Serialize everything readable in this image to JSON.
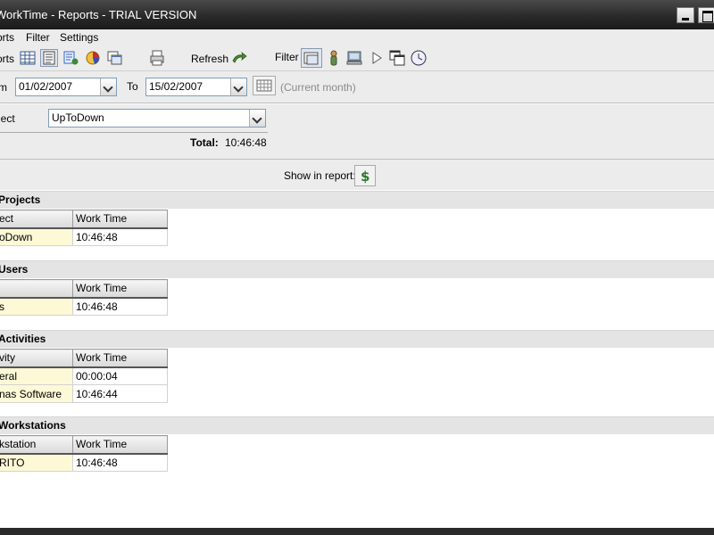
{
  "window": {
    "title": "WorkTime - Reports - TRIAL VERSION"
  },
  "menu": {
    "items": [
      "orts",
      "Filter",
      "Settings"
    ]
  },
  "toolbar": {
    "reports_label": "orts",
    "refresh_label": "Refresh",
    "filter_label": "Filter"
  },
  "dates": {
    "from_label": "m",
    "from_value": "01/02/2007",
    "to_label": "To",
    "to_value": "15/02/2007",
    "hint": "(Current month)"
  },
  "project": {
    "label": "ject",
    "value": "UpToDown",
    "total_label": "Total:",
    "total_value": "10:46:48"
  },
  "show": {
    "label": "Show in report:"
  },
  "sections": {
    "projects": {
      "title": "Projects",
      "headers": [
        "ect",
        "Work Time"
      ],
      "rows": [
        [
          "oDown",
          "10:46:48"
        ]
      ]
    },
    "users": {
      "title": "Users",
      "headers": [
        "",
        "Work Time"
      ],
      "rows": [
        [
          "s",
          "10:46:48"
        ]
      ]
    },
    "activities": {
      "title": "Activities",
      "headers": [
        "vity",
        "Work Time"
      ],
      "rows": [
        [
          "eral",
          "00:00:04"
        ],
        [
          "nas Software",
          "10:46:44"
        ]
      ]
    },
    "workstations": {
      "title": "Workstations",
      "headers": [
        "kstation",
        "Work Time"
      ],
      "rows": [
        [
          "RITO",
          "10:46:48"
        ]
      ]
    }
  },
  "colors": {
    "title_bg": "#2a2a2a",
    "panel_bg": "#ececec",
    "first_col_bg": "#fdf9d6"
  },
  "icons": [
    "grid-icon",
    "report-icon",
    "export-icon",
    "chart-icon",
    "window-icon",
    "print-icon",
    "refresh-arrow-icon",
    "filter-folder-icon",
    "user-icon",
    "computer-icon",
    "play-icon",
    "windows-icon",
    "clock-icon",
    "calendar-icon",
    "dollar-icon"
  ]
}
